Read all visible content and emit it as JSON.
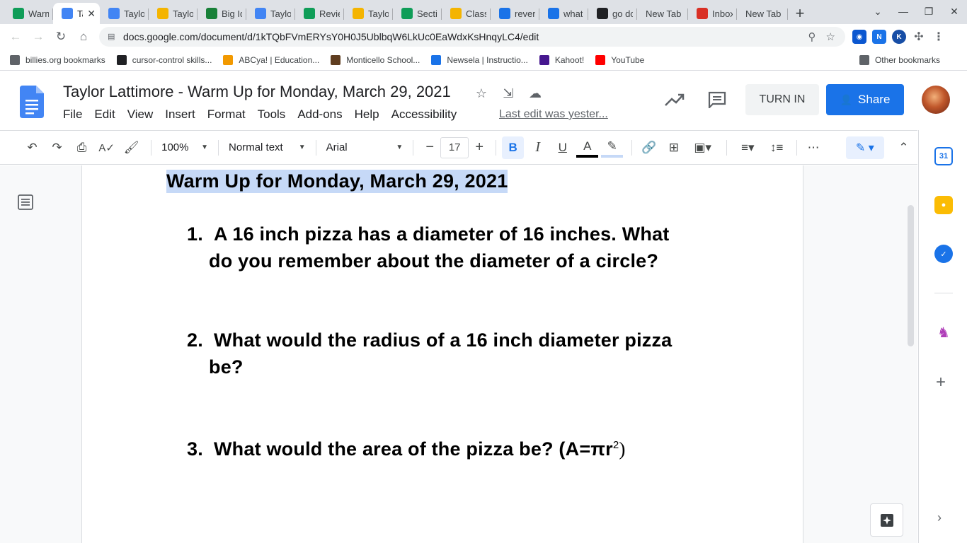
{
  "browser": {
    "tabs": [
      {
        "label": "Warm",
        "favicon": "classroom-icon",
        "color": "#0f9d58"
      },
      {
        "label": "Ta",
        "favicon": "docs-icon",
        "color": "#4285f4",
        "active": true
      },
      {
        "label": "Taylor",
        "favicon": "docs-icon",
        "color": "#4285f4"
      },
      {
        "label": "Taylor",
        "favicon": "slides-icon",
        "color": "#f4b400"
      },
      {
        "label": "Big Id",
        "favicon": "diamond-icon",
        "color": "#188038"
      },
      {
        "label": "Taylor",
        "favicon": "docs-icon",
        "color": "#4285f4"
      },
      {
        "label": "Revie",
        "favicon": "classroom-icon",
        "color": "#0f9d58"
      },
      {
        "label": "Taylor",
        "favicon": "slides-icon",
        "color": "#f4b400"
      },
      {
        "label": "Sectio",
        "favicon": "classroom-icon",
        "color": "#0f9d58"
      },
      {
        "label": "Class",
        "favicon": "classroom-icon",
        "color": "#f4b400"
      },
      {
        "label": "revers",
        "favicon": "bing-icon",
        "color": "#1a73e8"
      },
      {
        "label": "what",
        "favicon": "bing-icon",
        "color": "#1a73e8"
      },
      {
        "label": "go do",
        "favicon": "b-icon",
        "color": "#202124"
      },
      {
        "label": "New Tab",
        "favicon": "",
        "color": ""
      },
      {
        "label": "Inbox",
        "favicon": "gmail-icon",
        "color": "#d93025"
      },
      {
        "label": "New Tab",
        "favicon": "",
        "color": ""
      }
    ],
    "new_tab_glyph": "+",
    "url": "docs.google.com/document/d/1kTQbFVmERYsY0H0J5UblbqW6LkUc0EaWdxKsHnqyLC4/edit",
    "bookmarks": [
      {
        "label": "billies.org bookmarks",
        "icon": "bookmark-folder-icon",
        "color": "#5f6368"
      },
      {
        "label": "cursor-control skills...",
        "icon": "m-icon",
        "color": "#202124"
      },
      {
        "label": "ABCya! | Education...",
        "icon": "abcya-icon",
        "color": "#f29900"
      },
      {
        "label": "Monticello School...",
        "icon": "school-icon",
        "color": "#5f3d1f"
      },
      {
        "label": "Newsela | Instructio...",
        "icon": "newsela-icon",
        "color": "#1a73e8"
      },
      {
        "label": "Kahoot!",
        "icon": "kahoot-icon",
        "color": "#46178f"
      },
      {
        "label": "YouTube",
        "icon": "youtube-icon",
        "color": "#ff0000"
      }
    ],
    "other_bookmarks": "Other bookmarks"
  },
  "docs": {
    "title": "Taylor Lattimore - Warm Up for Monday, March 29, 2021",
    "menu": [
      "File",
      "Edit",
      "View",
      "Insert",
      "Format",
      "Tools",
      "Add-ons",
      "Help",
      "Accessibility"
    ],
    "last_edit": "Last edit was yester...",
    "turn_in": "TURN IN",
    "share": "Share",
    "toolbar": {
      "zoom": "100%",
      "style": "Normal text",
      "font": "Arial",
      "font_size": "17"
    }
  },
  "document": {
    "heading": "Warm Up for Monday, March 29, 2021",
    "questions": [
      {
        "num": "1.",
        "line1": "A 16 inch pizza has a diameter of 16 inches.  What",
        "line2": "do you remember about the diameter of a circle?"
      },
      {
        "num": "2.",
        "line1": "What would the radius of a 16 inch diameter pizza",
        "line2": "be?"
      },
      {
        "num": "3.",
        "line1": "What would the area of the pizza be?  (A=πr",
        "sup": "2",
        "close": ")"
      }
    ]
  },
  "colors": {
    "accent": "#1a73e8",
    "selection": "#c6d9f7"
  }
}
